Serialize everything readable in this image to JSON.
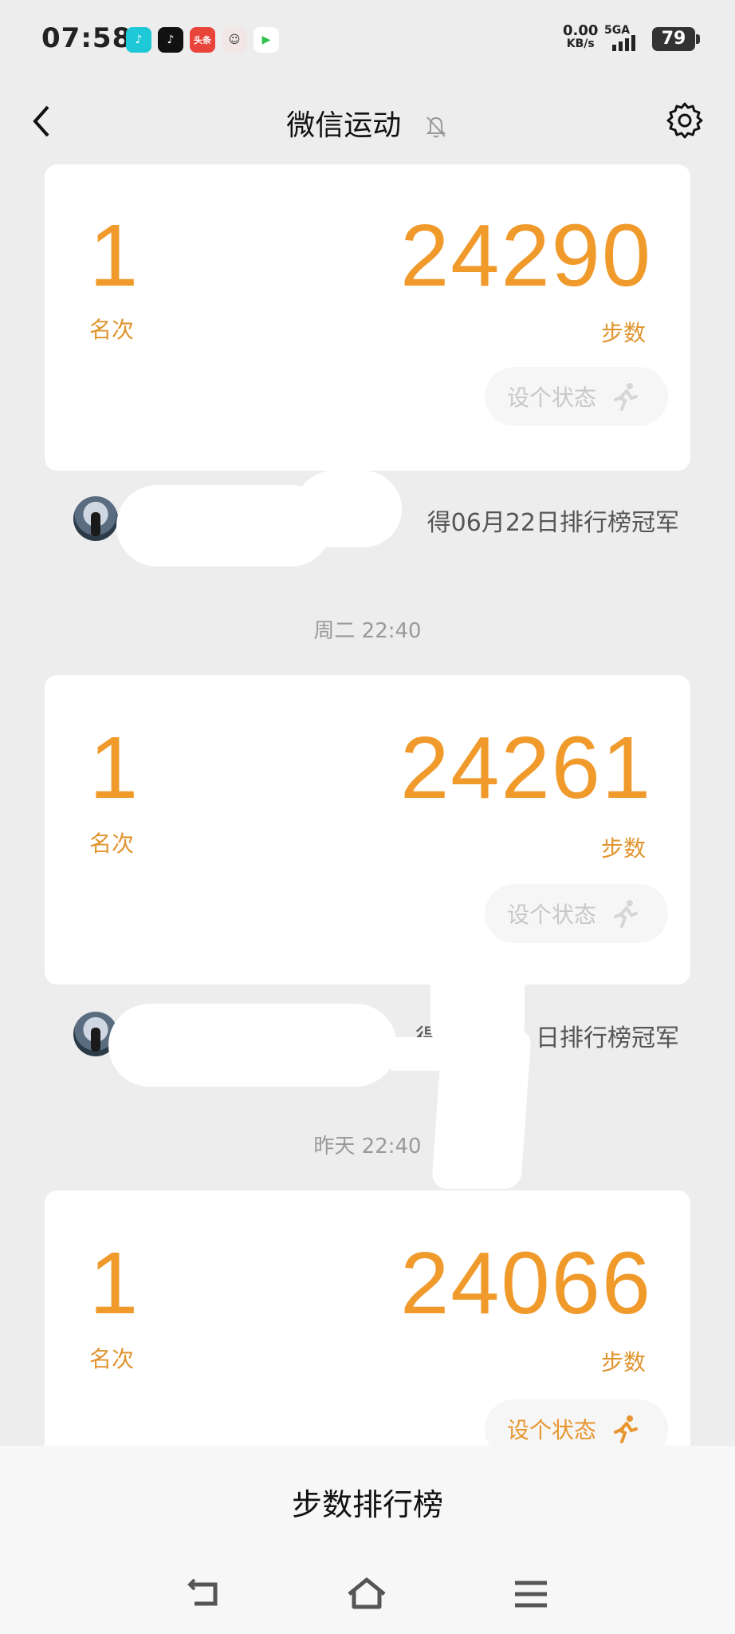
{
  "status_bar": {
    "time": "07:58",
    "net_speed_value": "0.00",
    "net_speed_unit": "KB/s",
    "network": "5GA",
    "battery": "79",
    "notification_icons": [
      "douyin-icon",
      "tiktok-icon",
      "toutiao-icon",
      "avatar-app-icon",
      "play-icon"
    ]
  },
  "nav": {
    "title": "微信运动",
    "back_icon": "chevron-left-icon",
    "mute_icon": "bell-off-icon",
    "settings_icon": "gear-icon"
  },
  "entries": [
    {
      "rank": "1",
      "rank_label": "名次",
      "steps": "24290",
      "steps_label": "步数",
      "status_button": "设个状态",
      "status_active": false,
      "champion_text": "得06月22日排行榜冠军"
    },
    {
      "timestamp": "周二 22:40",
      "rank": "1",
      "rank_label": "名次",
      "steps": "24261",
      "steps_label": "步数",
      "status_button": "设个状态",
      "status_active": false,
      "champion_text": "得0",
      "champion_text_tail": "日排行榜冠军"
    },
    {
      "timestamp": "昨天 22:40",
      "rank": "1",
      "rank_label": "名次",
      "steps": "24066",
      "steps_label": "步数",
      "status_button": "设个状态",
      "status_active": true
    }
  ],
  "bottom": {
    "title": "步数排行榜"
  },
  "colors": {
    "accent": "#f09a2c",
    "background": "#ededed",
    "card": "#ffffff"
  }
}
